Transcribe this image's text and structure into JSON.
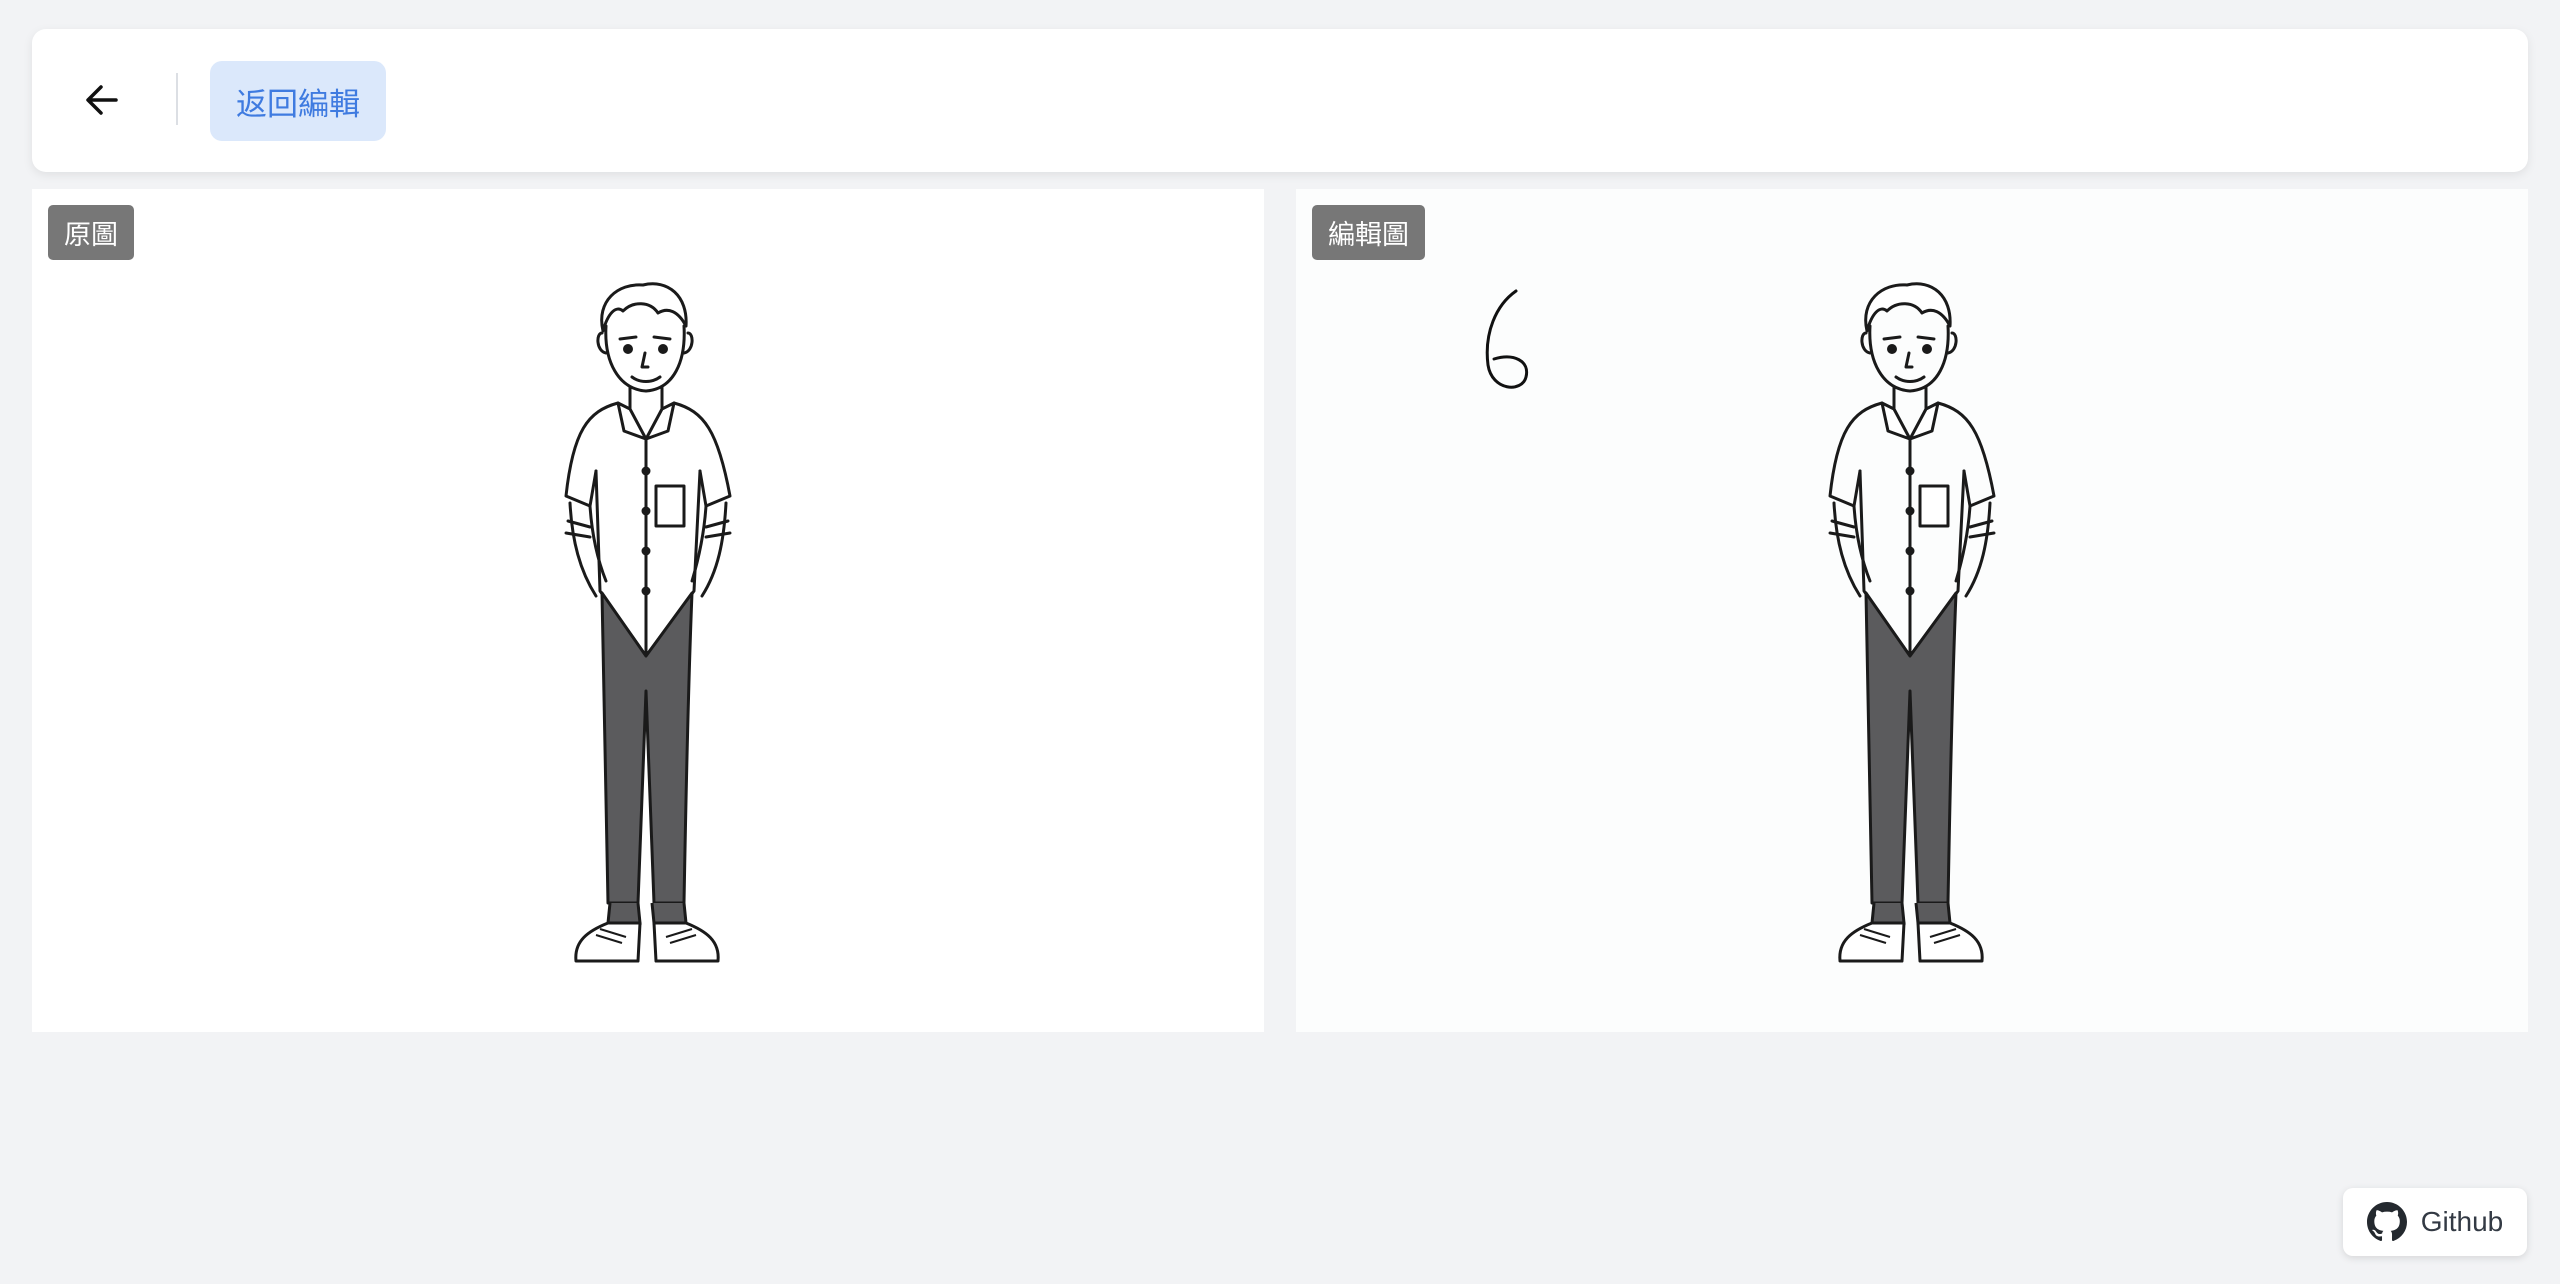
{
  "header": {
    "back_button_label": "返回編輯"
  },
  "panels": {
    "original_label": "原圖",
    "edited_label": "編輯圖"
  },
  "footer": {
    "github_label": "Github"
  },
  "icons": {
    "back": "arrow-left-icon",
    "github": "github-icon"
  },
  "colors": {
    "accent": "#3f7be0",
    "accent_bg": "#dbe8fb",
    "tag_bg": "#777777",
    "page_bg": "#f2f3f5"
  }
}
